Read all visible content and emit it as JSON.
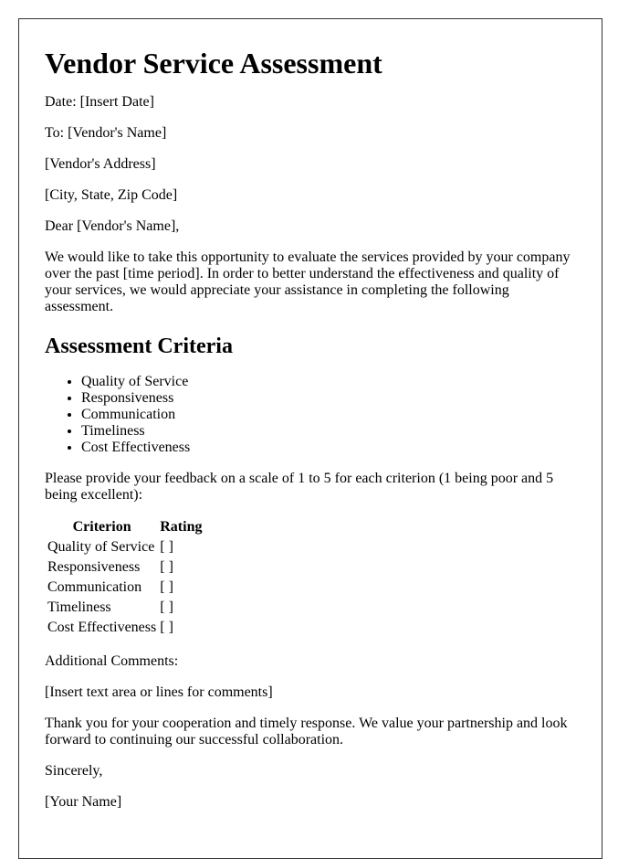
{
  "document": {
    "title": "Vendor Service Assessment",
    "date_line": "Date: [Insert Date]",
    "to_line": "To: [Vendor's Name]",
    "address_line": "[Vendor's Address]",
    "city_line": "[City, State, Zip Code]",
    "salutation": "Dear [Vendor's Name],",
    "intro": "We would like to take this opportunity to evaluate the services provided by your company over the past [time period]. In order to better understand the effectiveness and quality of your services, we would appreciate your assistance in completing the following assessment.",
    "criteria_heading": "Assessment Criteria",
    "criteria": [
      "Quality of Service",
      "Responsiveness",
      "Communication",
      "Timeliness",
      "Cost Effectiveness"
    ],
    "scale_instruction": "Please provide your feedback on a scale of 1 to 5 for each criterion (1 being poor and 5 being excellent):",
    "table": {
      "headers": [
        "Criterion",
        "Rating"
      ],
      "rows": [
        {
          "criterion": "Quality of Service",
          "rating": "[ ]"
        },
        {
          "criterion": "Responsiveness",
          "rating": "[ ]"
        },
        {
          "criterion": "Communication",
          "rating": "[ ]"
        },
        {
          "criterion": "Timeliness",
          "rating": "[ ]"
        },
        {
          "criterion": "Cost Effectiveness",
          "rating": "[ ]"
        }
      ]
    },
    "comments_label": "Additional Comments:",
    "comments_placeholder": "[Insert text area or lines for comments]",
    "closing_paragraph": "Thank you for your cooperation and timely response. We value your partnership and look forward to continuing our successful collaboration.",
    "signoff": "Sincerely,",
    "signature": "[Your Name]"
  }
}
